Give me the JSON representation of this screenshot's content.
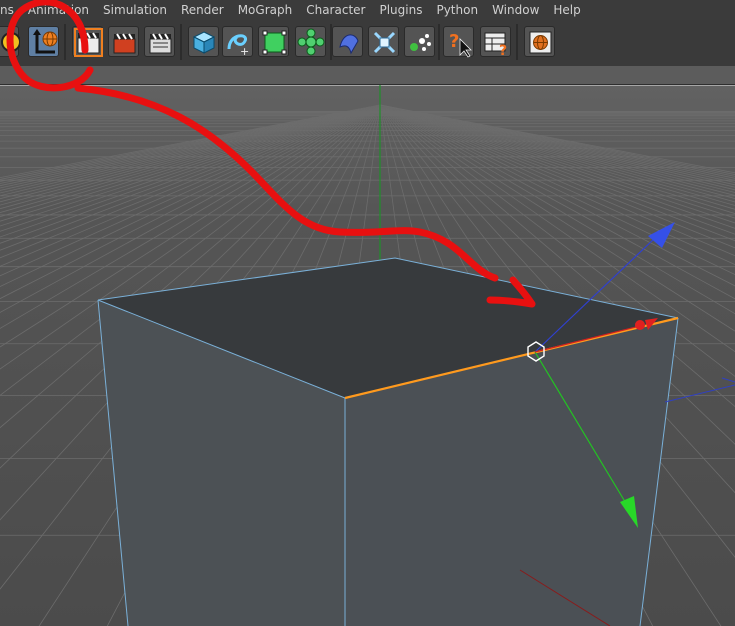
{
  "menu": [
    "ns",
    "Animation",
    "Simulation",
    "Render",
    "MoGraph",
    "Character",
    "Plugins",
    "Python",
    "Window",
    "Help"
  ],
  "toolbar": {
    "buttons": [
      {
        "name": "undo-button",
        "icon": "undo-icon"
      },
      {
        "name": "object-axis-button",
        "icon": "axis-globe-icon",
        "active": true
      },
      {
        "name": "render-region-button",
        "icon": "clapper-icon"
      },
      {
        "name": "render-picture-viewer-button",
        "icon": "clapper-red-icon"
      },
      {
        "name": "render-settings-button",
        "icon": "clapper-settings-icon"
      },
      {
        "name": "cube-button",
        "icon": "cube-icon"
      },
      {
        "name": "spline-button",
        "icon": "spline-icon"
      },
      {
        "name": "nurbs-button",
        "icon": "subdivision-icon"
      },
      {
        "name": "array-button",
        "icon": "array-icon"
      },
      {
        "name": "deformer-button",
        "icon": "deformer-icon"
      },
      {
        "name": "scene-button",
        "icon": "scene-icon"
      },
      {
        "name": "effector-button",
        "icon": "effector-icon"
      },
      {
        "name": "help-button",
        "icon": "help-question-icon"
      },
      {
        "name": "layout-button",
        "icon": "layout-icon"
      },
      {
        "name": "web-button",
        "icon": "globe-icon"
      }
    ]
  },
  "colors": {
    "annotation": "#e81010",
    "selected_edge": "#ff9a1e",
    "axis_x": "#e02020",
    "axis_y": "#22c422",
    "axis_z": "#3050e0",
    "cube_top": "#373a3d",
    "cube_side": "#4c5155"
  }
}
